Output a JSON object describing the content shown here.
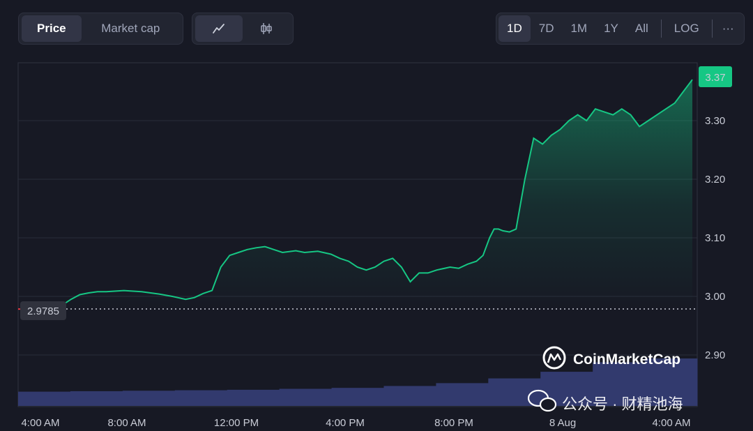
{
  "tabs": {
    "price_label": "Price",
    "marketcap_label": "Market cap",
    "line_icon": "line-chart-icon",
    "candle_icon": "candlestick-icon"
  },
  "ranges": {
    "items": [
      "1D",
      "7D",
      "1M",
      "1Y",
      "All"
    ],
    "active": "1D",
    "log_label": "LOG",
    "more_label": "···"
  },
  "colors": {
    "up": "#16c784",
    "down": "#ea3943",
    "bg": "#171924",
    "volume": "#323a6e"
  },
  "watermark": {
    "brand": "CoinMarketCap",
    "wechat_name": "公众号 · 财精池海"
  },
  "chart_data": {
    "type": "area",
    "ylim": [
      2.85,
      3.4
    ],
    "ytick_values": [
      3.0,
      3.1,
      3.2,
      3.3
    ],
    "ytick_labels": [
      "3.00",
      "3.10",
      "3.20",
      "3.30",
      "2.90"
    ],
    "xtick_labels": [
      "4:00 AM",
      "8:00 AM",
      "12:00 PM",
      "4:00 PM",
      "8:00 PM",
      "8 Aug",
      "4:00 AM"
    ],
    "open_price": 2.9785,
    "open_label": "2.9785",
    "last_price": 3.37,
    "last_label": "3.37",
    "x_hours": [
      0,
      0.6,
      1.2,
      1.6,
      1.8,
      2.0,
      2.4,
      2.8,
      3.2,
      3.6,
      4.0,
      4.8,
      5.6,
      6.4,
      7.0,
      7.6,
      8.0,
      8.4,
      8.8,
      9.2,
      9.6,
      10.0,
      10.4,
      10.8,
      11.2,
      11.6,
      12.0,
      12.6,
      13.0,
      13.6,
      14.2,
      14.6,
      15.0,
      15.4,
      15.8,
      16.2,
      16.6,
      17.0,
      17.4,
      17.8,
      18.2,
      18.6,
      19.0,
      19.6,
      20.0,
      20.4,
      20.8,
      21.1,
      21.4,
      21.6,
      21.8,
      22.0,
      22.3,
      22.6,
      23.0,
      23.4,
      23.8,
      24.2,
      24.6,
      25.0,
      25.4,
      25.8,
      26.2,
      26.6,
      27.0,
      27.4,
      27.8,
      28.2,
      28.6,
      29.0,
      29.4,
      29.8,
      30.2,
      30.6
    ],
    "price": [
      2.9785,
      2.978,
      2.975,
      2.972,
      2.98,
      2.985,
      2.995,
      3.003,
      3.006,
      3.008,
      3.008,
      3.01,
      3.008,
      3.004,
      3.0,
      2.995,
      2.998,
      3.005,
      3.01,
      3.05,
      3.07,
      3.075,
      3.08,
      3.083,
      3.085,
      3.08,
      3.075,
      3.078,
      3.075,
      3.077,
      3.072,
      3.065,
      3.06,
      3.05,
      3.045,
      3.05,
      3.06,
      3.065,
      3.05,
      3.025,
      3.04,
      3.04,
      3.045,
      3.05,
      3.048,
      3.055,
      3.06,
      3.07,
      3.1,
      3.115,
      3.115,
      3.112,
      3.11,
      3.115,
      3.2,
      3.27,
      3.26,
      3.275,
      3.285,
      3.3,
      3.31,
      3.3,
      3.32,
      3.315,
      3.31,
      3.32,
      3.31,
      3.29,
      3.3,
      3.31,
      3.32,
      3.33,
      3.35,
      3.37
    ],
    "volume_rel": [
      0.3,
      0.31,
      0.32,
      0.33,
      0.34,
      0.36,
      0.38,
      0.42,
      0.48,
      0.58,
      0.72,
      0.92,
      1.0
    ]
  }
}
